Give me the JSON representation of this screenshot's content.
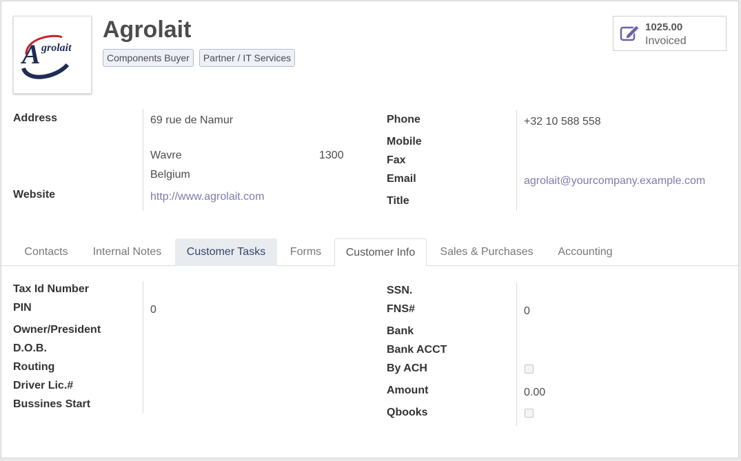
{
  "partner": {
    "name": "Agrolait",
    "logo_text": "Agrolait",
    "tags": [
      "Components Buyer",
      "Partner / IT Services"
    ]
  },
  "invoiced": {
    "value": "1025.00",
    "label": "Invoiced",
    "icon": "pencil-square-icon"
  },
  "address": {
    "label": "Address",
    "street": "69 rue de Namur",
    "city": "Wavre",
    "zip": "1300",
    "country": "Belgium"
  },
  "website": {
    "label": "Website",
    "value": "http://www.agrolait.com"
  },
  "contact": {
    "phone_label": "Phone",
    "phone": "+32 10 588 558",
    "mobile_label": "Mobile",
    "mobile": "",
    "fax_label": "Fax",
    "fax": "",
    "email_label": "Email",
    "email": "agrolait@yourcompany.example.com",
    "title_label": "Title",
    "title": ""
  },
  "tabs": [
    {
      "label": "Contacts",
      "state": "normal"
    },
    {
      "label": "Internal Notes",
      "state": "normal"
    },
    {
      "label": "Customer Tasks",
      "state": "hover"
    },
    {
      "label": "Forms",
      "state": "normal"
    },
    {
      "label": "Customer Info",
      "state": "active"
    },
    {
      "label": "Sales & Purchases",
      "state": "normal"
    },
    {
      "label": "Accounting",
      "state": "normal"
    }
  ],
  "customer_info": {
    "left": {
      "tax_id_label": "Tax Id Number",
      "tax_id": "",
      "pin_label": "PIN",
      "pin": "0",
      "owner_label": "Owner/President",
      "owner": "",
      "dob_label": "D.O.B.",
      "dob": "",
      "routing_label": "Routing",
      "routing": "",
      "driver_label": "Driver Lic.#",
      "driver": "",
      "business_start_label": "Bussines Start",
      "business_start": ""
    },
    "right": {
      "ssn_label": "SSN.",
      "ssn": "",
      "fns_label": "FNS#",
      "fns": "0",
      "bank_label": "Bank",
      "bank": "",
      "bank_acct_label": "Bank ACCT",
      "bank_acct": "",
      "by_ach_label": "By ACH",
      "by_ach": false,
      "amount_label": "Amount",
      "amount": "0.00",
      "qbooks_label": "Qbooks",
      "qbooks": false
    }
  },
  "colors": {
    "link": "#7c7bad",
    "logo_red": "#c8202f",
    "logo_navy": "#1e2d55",
    "icon": "#6b62a5"
  }
}
